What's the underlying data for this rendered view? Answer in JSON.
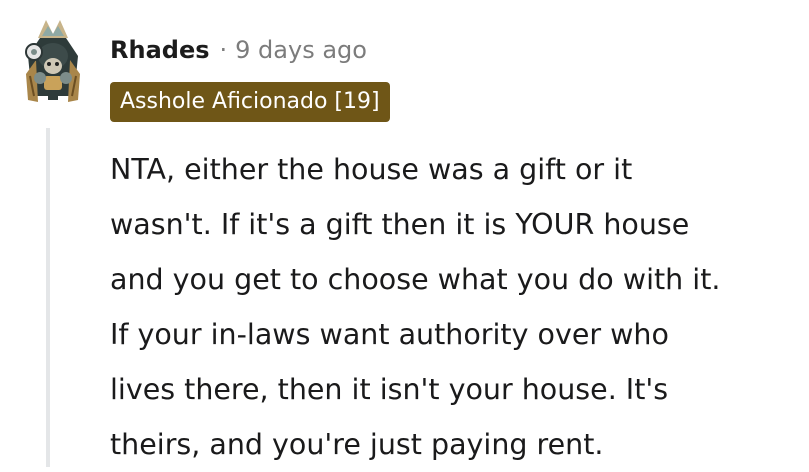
{
  "comment": {
    "author": {
      "username": "Rhades",
      "avatar_icon": "knight-avatar-icon"
    },
    "separator": "·",
    "timestamp": "9 days ago",
    "flair": {
      "text": "Asshole Aficionado [19]",
      "color": "#6f5617"
    },
    "body_lines": [
      "NTA, either the house was a gift or it",
      "wasn't. If it's a gift then it is YOUR house",
      "and you get to choose what you do with it.",
      "If your in-laws want authority over who",
      "lives there, then it isn't your house. It's",
      "theirs, and you're just paying rent."
    ]
  },
  "colors": {
    "thread_line": "#e4e6e8",
    "meta_text": "#7c7c7c",
    "body_text": "#1a1a1b"
  }
}
